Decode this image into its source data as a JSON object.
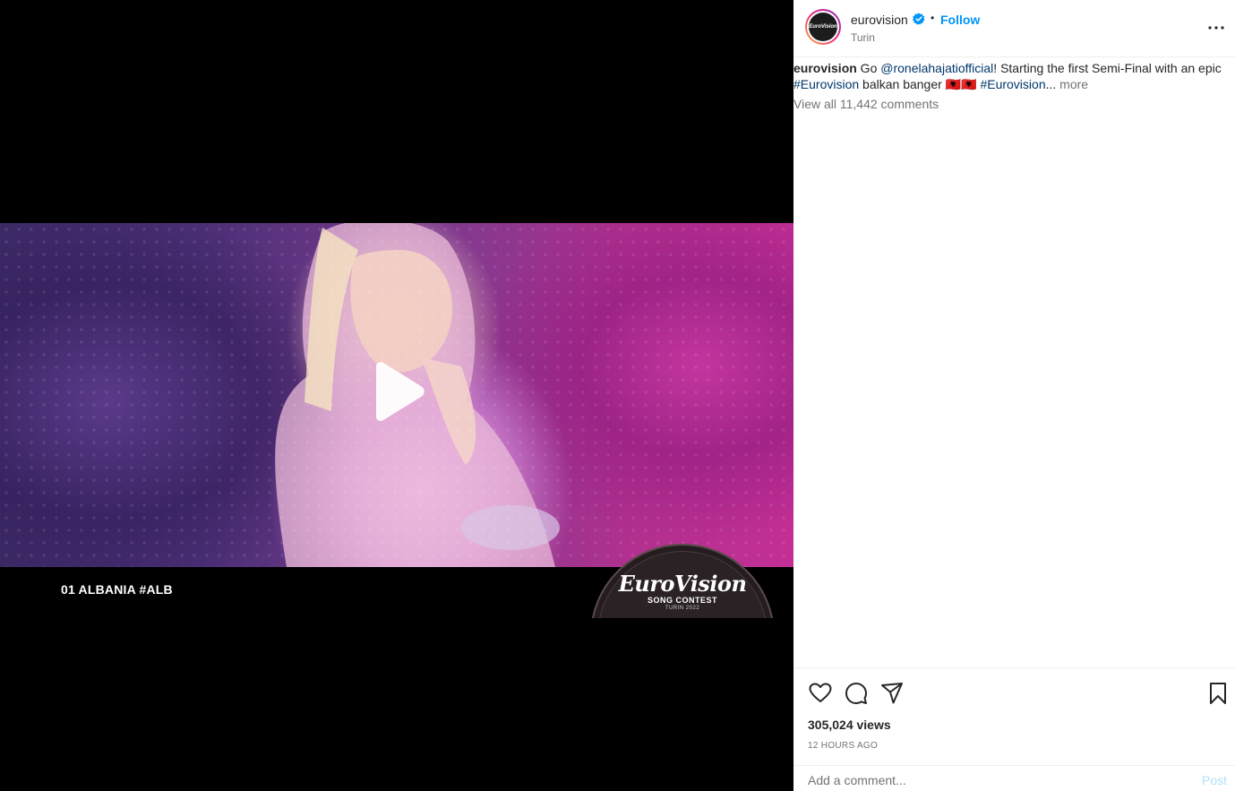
{
  "media": {
    "caption_overlay": "01 ALBANIA #ALB",
    "logo": {
      "word": "EuroVision",
      "sub": "SONG CONTEST",
      "sub2": "TURIN 2022"
    }
  },
  "post": {
    "username": "eurovision",
    "separator": "•",
    "follow_label": "Follow",
    "location": "Turin",
    "caption": {
      "username": "eurovision",
      "text_1": " Go ",
      "mention": "@ronelahajatiofficial",
      "text_2": "! Starting the first Semi-Final with an epic ",
      "hashtag_1": "#Eurovision",
      "text_3": " balkan banger ",
      "emoji": "🇦🇱🇦🇱",
      "hashtag_2": "#Eurovision",
      "ellipsis": "...",
      "more_label": " more"
    },
    "view_comments": "View all 11,442 comments",
    "views": "305,024 views",
    "time": "12 HOURS AGO",
    "comment_placeholder": "Add a comment...",
    "post_label": "Post"
  },
  "colors": {
    "accent": "#0095f6",
    "link": "#00376b",
    "muted": "#737373"
  },
  "icons": [
    "play-icon",
    "verified-icon",
    "more-options-icon",
    "heart-icon",
    "comment-icon",
    "share-icon",
    "bookmark-icon"
  ]
}
